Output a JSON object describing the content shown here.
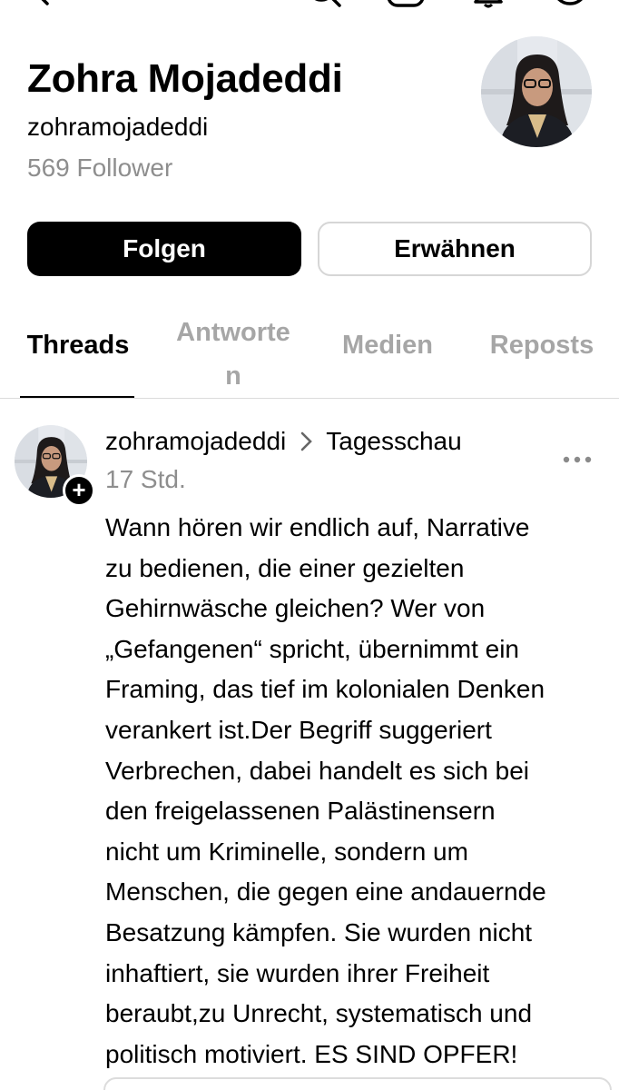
{
  "top_bar": {
    "icons": [
      "back-icon",
      "search-icon",
      "instagram-icon",
      "notifications-icon",
      "more-icon"
    ]
  },
  "profile": {
    "name": "Zohra Mojadeddi",
    "handle": "zohramojadeddi",
    "followers": "569 Follower"
  },
  "actions": {
    "follow_label": "Folgen",
    "mention_label": "Erwähnen"
  },
  "tabs": [
    {
      "label": "Threads",
      "active": true
    },
    {
      "label": "Antworten",
      "active": false
    },
    {
      "label": "Medien",
      "active": false
    },
    {
      "label": "Reposts",
      "active": false
    }
  ],
  "post": {
    "author": "zohramojadeddi",
    "community": "Tagesschau",
    "time": "17 Std.",
    "lines": [
      "Wann hören wir endlich auf, Narrative",
      "zu bedienen, die einer gezielten",
      "Gehirnwäsche gleichen? Wer von",
      "„Gefangenen“ spricht, übernimmt ein",
      "Framing, das tief im kolonialen Denken",
      "verankert ist.Der Begriff suggeriert",
      "Verbrechen, dabei handelt es sich bei",
      "den freigelassenen Palästinensern",
      "nicht um Kriminelle, sondern um",
      "Menschen, die gegen eine andauernde",
      "Besatzung kämpfen. Sie wurden nicht",
      "inhaftiert, sie wurden ihrer Freiheit",
      "beraubt,zu Unrecht, systematisch und",
      "politisch motiviert. ES SIND OPFER!"
    ]
  },
  "colors": {
    "primary": "#000000",
    "muted": "#8e8e8e",
    "tab_inactive": "#a6a6a6",
    "divider": "#dbdbdb",
    "background": "#ffffff"
  }
}
